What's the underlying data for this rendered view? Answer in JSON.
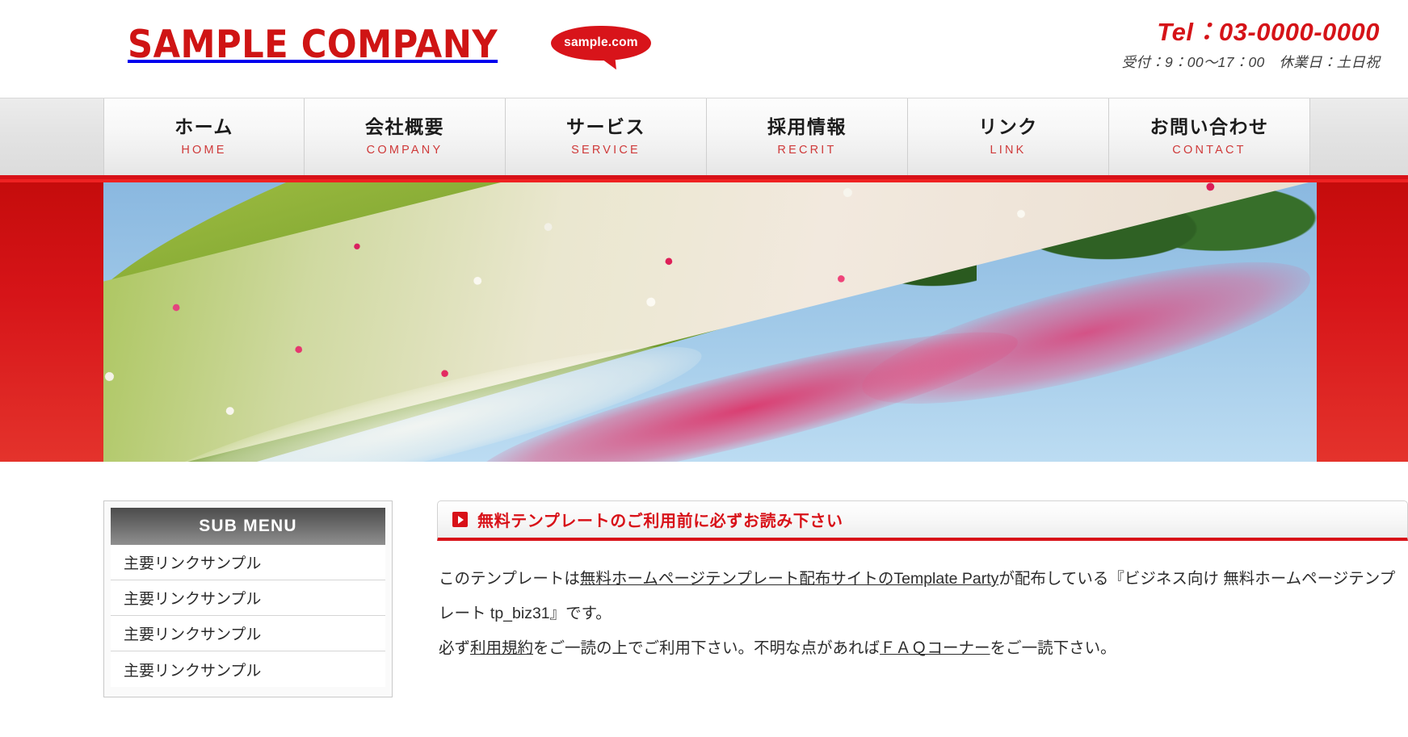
{
  "header": {
    "logo_text": "SAMPLE COMPANY",
    "bubble_text": "sample.com",
    "tel": "Tel：03-0000-0000",
    "hours": "受付：9：00～17：00　休業日：土日祝"
  },
  "nav": {
    "items": [
      {
        "ja": "ホーム",
        "en": "HOME"
      },
      {
        "ja": "会社概要",
        "en": "COMPANY"
      },
      {
        "ja": "サービス",
        "en": "SERVICE"
      },
      {
        "ja": "採用情報",
        "en": "RECRIT"
      },
      {
        "ja": "リンク",
        "en": "LINK"
      },
      {
        "ja": "お問い合わせ",
        "en": "CONTACT"
      }
    ]
  },
  "sidebar": {
    "title": "SUB MENU",
    "items": [
      "主要リンクサンプル",
      "主要リンクサンプル",
      "主要リンクサンプル",
      "主要リンクサンプル"
    ]
  },
  "main": {
    "notice_heading": "無料テンプレートのご利用前に必ずお読み下さい",
    "para1_a": "このテンプレートは",
    "para1_link1": "無料ホームページテンプレート配布サイトのTemplate Party",
    "para1_b": "が配布している『ビジネス向け 無料ホームページテンプレート tp_biz31』です。",
    "para2_a": "必ず",
    "para2_link1": "利用規約",
    "para2_b": "をご一読の上でご利用下さい。不明な点があれば",
    "para2_link2": "ＦＡＱコーナー",
    "para2_c": "をご一読下さい。"
  },
  "colors": {
    "brand_red": "#d81118",
    "logo_red": "#cf1414",
    "nav_en_red": "#cf3a3a",
    "nav_bg": "#e3e3e3",
    "submenu_header": "#6b6b6b"
  }
}
